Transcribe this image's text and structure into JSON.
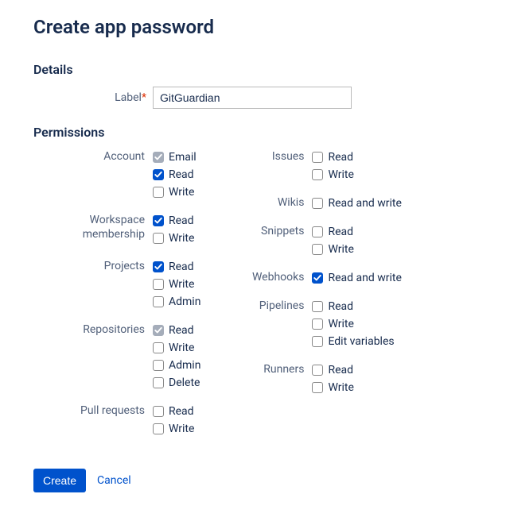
{
  "title": "Create app password",
  "sections": {
    "details": "Details",
    "permissions": "Permissions"
  },
  "label_field": {
    "label": "Label",
    "value": "GitGuardian"
  },
  "perm_groups_left": [
    {
      "name": "Account",
      "options": [
        {
          "label": "Email",
          "checked": true,
          "disabled": true
        },
        {
          "label": "Read",
          "checked": true,
          "disabled": false
        },
        {
          "label": "Write",
          "checked": false,
          "disabled": false
        }
      ]
    },
    {
      "name": "Workspace membership",
      "options": [
        {
          "label": "Read",
          "checked": true,
          "disabled": false
        },
        {
          "label": "Write",
          "checked": false,
          "disabled": false
        }
      ]
    },
    {
      "name": "Projects",
      "options": [
        {
          "label": "Read",
          "checked": true,
          "disabled": false
        },
        {
          "label": "Write",
          "checked": false,
          "disabled": false
        },
        {
          "label": "Admin",
          "checked": false,
          "disabled": false
        }
      ]
    },
    {
      "name": "Repositories",
      "options": [
        {
          "label": "Read",
          "checked": true,
          "disabled": true
        },
        {
          "label": "Write",
          "checked": false,
          "disabled": false
        },
        {
          "label": "Admin",
          "checked": false,
          "disabled": false
        },
        {
          "label": "Delete",
          "checked": false,
          "disabled": false
        }
      ]
    },
    {
      "name": "Pull requests",
      "options": [
        {
          "label": "Read",
          "checked": false,
          "disabled": false
        },
        {
          "label": "Write",
          "checked": false,
          "disabled": false
        }
      ]
    }
  ],
  "perm_groups_right": [
    {
      "name": "Issues",
      "options": [
        {
          "label": "Read",
          "checked": false,
          "disabled": false
        },
        {
          "label": "Write",
          "checked": false,
          "disabled": false
        }
      ]
    },
    {
      "name": "Wikis",
      "options": [
        {
          "label": "Read and write",
          "checked": false,
          "disabled": false
        }
      ]
    },
    {
      "name": "Snippets",
      "options": [
        {
          "label": "Read",
          "checked": false,
          "disabled": false
        },
        {
          "label": "Write",
          "checked": false,
          "disabled": false
        }
      ]
    },
    {
      "name": "Webhooks",
      "options": [
        {
          "label": "Read and write",
          "checked": true,
          "disabled": false
        }
      ]
    },
    {
      "name": "Pipelines",
      "options": [
        {
          "label": "Read",
          "checked": false,
          "disabled": false
        },
        {
          "label": "Write",
          "checked": false,
          "disabled": false
        },
        {
          "label": "Edit variables",
          "checked": false,
          "disabled": false
        }
      ]
    },
    {
      "name": "Runners",
      "options": [
        {
          "label": "Read",
          "checked": false,
          "disabled": false
        },
        {
          "label": "Write",
          "checked": false,
          "disabled": false
        }
      ]
    }
  ],
  "actions": {
    "create": "Create",
    "cancel": "Cancel"
  }
}
